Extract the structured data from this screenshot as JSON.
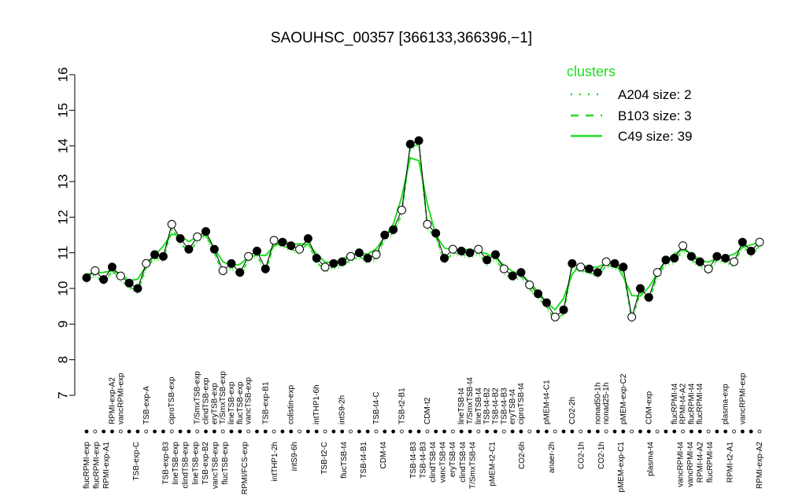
{
  "chart_data": {
    "type": "line",
    "title": "SAOUHSC_00357 [366133,366396,−1]",
    "xlabel": "",
    "ylabel": "",
    "ylim": [
      7,
      16
    ],
    "y_ticks": [
      7,
      8,
      9,
      10,
      11,
      12,
      13,
      14,
      15,
      16
    ],
    "legend": {
      "title": "clusters",
      "position": "top-right",
      "color": "#22dd22",
      "entries": [
        {
          "label": "A204 size: 2",
          "style": "dotted"
        },
        {
          "label": "B103 size: 3",
          "style": "dashed"
        },
        {
          "label": "C49 size: 39",
          "style": "solid"
        }
      ]
    },
    "colors": {
      "line": "#000000",
      "cluster": "#22dd22"
    },
    "x_labels_top": [
      {
        "i": 3,
        "label": "RPMI-exp-A2"
      },
      {
        "i": 4,
        "label": "vancRPMI-exp"
      },
      {
        "i": 7,
        "label": "TSB-exp-A"
      },
      {
        "i": 10,
        "label": "ciproTSB-exp"
      },
      {
        "i": 13,
        "label": "T/SmxTSB-exp"
      },
      {
        "i": 14,
        "label": "clindTSB-exp"
      },
      {
        "i": 15,
        "label": "eryTSB-exp"
      },
      {
        "i": 16,
        "label": "T/SmxTSB-exp"
      },
      {
        "i": 17,
        "label": "lineTSB-exp"
      },
      {
        "i": 18,
        "label": "flucTSB-exp"
      },
      {
        "i": 19,
        "label": "vancTSB-exp"
      },
      {
        "i": 21,
        "label": "TSB-exp-B1"
      },
      {
        "i": 24,
        "label": "colistin-exp"
      },
      {
        "i": 27,
        "label": "intTHP1-6h"
      },
      {
        "i": 30,
        "label": "intS9-2h"
      },
      {
        "i": 34,
        "label": "TSB-t4-C"
      },
      {
        "i": 37,
        "label": "TSB-t2-B1"
      },
      {
        "i": 40,
        "label": "CDM-t2"
      },
      {
        "i": 44,
        "label": "lineTSB-t4"
      },
      {
        "i": 45,
        "label": "T/SmxTSB-t4"
      },
      {
        "i": 46,
        "label": "lineTSB-t4"
      },
      {
        "i": 47,
        "label": "TSB-t4-B2"
      },
      {
        "i": 48,
        "label": "TSB-t4-B2"
      },
      {
        "i": 49,
        "label": "TSB-t4-B3"
      },
      {
        "i": 50,
        "label": "eryTSB-t4"
      },
      {
        "i": 51,
        "label": "ciproTSB-t4"
      },
      {
        "i": 54,
        "label": "pMEM-t4-C1"
      },
      {
        "i": 57,
        "label": "CO2-2h"
      },
      {
        "i": 60,
        "label": "nonad50-1h"
      },
      {
        "i": 61,
        "label": "nonad25-1h"
      },
      {
        "i": 63,
        "label": "pMEM-exp-C2"
      },
      {
        "i": 66,
        "label": "CDM-exp"
      },
      {
        "i": 69,
        "label": "flucRPMI-t4"
      },
      {
        "i": 70,
        "label": "RPMI-t4-A2"
      },
      {
        "i": 71,
        "label": "flucRPMI-t4"
      },
      {
        "i": 72,
        "label": "flucRPMI-t4"
      },
      {
        "i": 75,
        "label": "plasma-exp"
      },
      {
        "i": 77,
        "label": "vancRPMI-exp"
      }
    ],
    "x_labels_bottom": [
      {
        "i": 0,
        "label": "flucRPMI-exp"
      },
      {
        "i": 1,
        "label": "flucRPMI-exp"
      },
      {
        "i": 2,
        "label": "RPMI-exp-A1"
      },
      {
        "i": 5,
        "label": "TSB-exp-C"
      },
      {
        "i": 8,
        "label": "TSB-exp-B3"
      },
      {
        "i": 9,
        "label": "lineTSB-exp"
      },
      {
        "i": 10,
        "label": "clindTSB-exp"
      },
      {
        "i": 11,
        "label": "lineTSB-exp"
      },
      {
        "i": 12,
        "label": "TSB-exp-B2"
      },
      {
        "i": 13,
        "label": "vancTSB-exp"
      },
      {
        "i": 14,
        "label": "flucTSB-exp"
      },
      {
        "i": 16,
        "label": "RPMI/FCS-exp"
      },
      {
        "i": 19,
        "label": "intTHP1-2h"
      },
      {
        "i": 21,
        "label": "intS9-6h"
      },
      {
        "i": 24,
        "label": "TSB-t2-C"
      },
      {
        "i": 26,
        "label": "flucTSB-t4"
      },
      {
        "i": 28,
        "label": "TSB-t4-B1"
      },
      {
        "i": 30,
        "label": "CDM-t4"
      },
      {
        "i": 33,
        "label": "TSB-t4-B3"
      },
      {
        "i": 34,
        "label": "TSB-t4-B3"
      },
      {
        "i": 35,
        "label": "clindTSB-t4"
      },
      {
        "i": 36,
        "label": "vancTSB-t4"
      },
      {
        "i": 37,
        "label": "eryTSB-t4"
      },
      {
        "i": 38,
        "label": "clindTSB-t4"
      },
      {
        "i": 39,
        "label": "T/SmxTSB-t4"
      },
      {
        "i": 41,
        "label": "pMEM-t2-C1"
      },
      {
        "i": 44,
        "label": "CO2-6h"
      },
      {
        "i": 47,
        "label": "anaer-2h"
      },
      {
        "i": 50,
        "label": "CO2-1h"
      },
      {
        "i": 52,
        "label": "CO2-1h"
      },
      {
        "i": 54,
        "label": "pMEM-exp-C1"
      },
      {
        "i": 57,
        "label": "plasma-t4"
      },
      {
        "i": 60,
        "label": "vancRPMI-t4"
      },
      {
        "i": 61,
        "label": "vancRPMI-t4"
      },
      {
        "i": 62,
        "label": "RPMI-t4-A2"
      },
      {
        "i": 63,
        "label": "flucRPMI-t4"
      },
      {
        "i": 65,
        "label": "RPMI-t2-A1"
      },
      {
        "i": 68,
        "label": "RPMI-exp-A2"
      }
    ],
    "series": [
      {
        "values": [
          10.3,
          10.5,
          10.25,
          10.6,
          10.35,
          10.15,
          10.0,
          10.7,
          10.95,
          10.9,
          11.8,
          11.4,
          11.1,
          11.45,
          11.6,
          11.1,
          10.5,
          10.7,
          10.45,
          10.9,
          11.05,
          10.55,
          11.35,
          11.3,
          11.2,
          11.1,
          11.4,
          10.85,
          10.6,
          10.7,
          10.75,
          10.9,
          11.0,
          10.85,
          10.95,
          11.5,
          11.65,
          12.2,
          14.05,
          14.15,
          11.8,
          11.55,
          10.85,
          11.1,
          11.05,
          11.0,
          11.1,
          10.8,
          10.95,
          10.55,
          10.35,
          10.45,
          10.1,
          9.85,
          9.6,
          9.2,
          9.4,
          10.7,
          10.6,
          10.55,
          10.45,
          10.75,
          10.7,
          10.6,
          9.2,
          10.0,
          9.75,
          10.45,
          10.8,
          10.85,
          11.2,
          10.9,
          10.75,
          10.55,
          10.9,
          10.85,
          10.75,
          11.3,
          11.05,
          11.3
        ]
      }
    ]
  }
}
